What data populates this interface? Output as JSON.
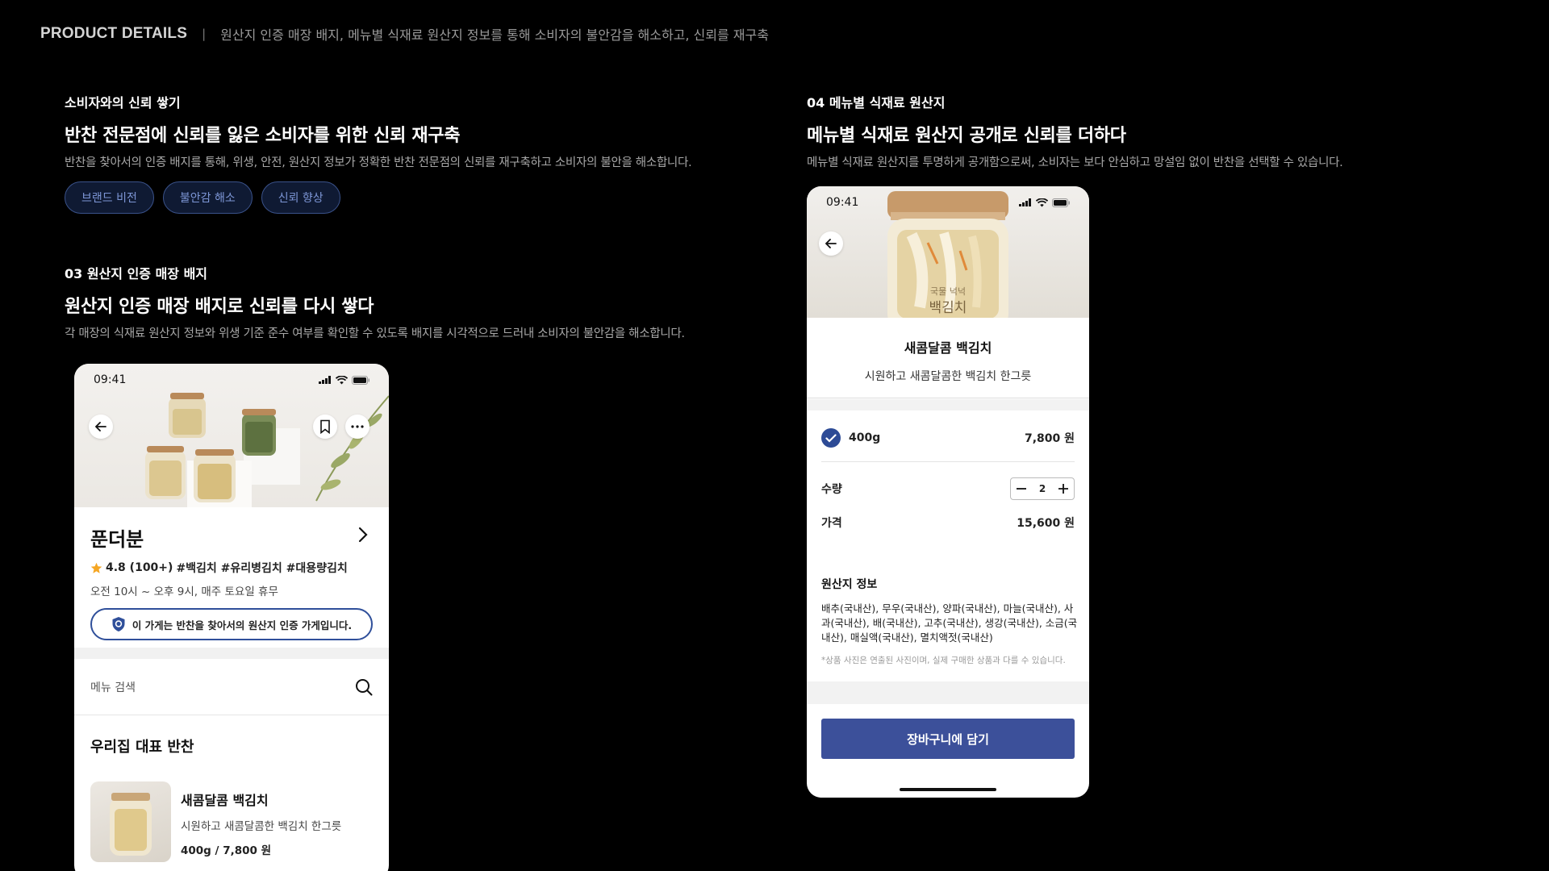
{
  "header": {
    "title": "PRODUCT DETAILS",
    "separator": "|",
    "description": "원산지 인증 매장 배지, 메뉴별 식재료 원산지 정보를 통해 소비자의 불안감을 해소하고, 신뢰를 재구축"
  },
  "section_trust": {
    "eyebrow": "소비자와의 신뢰 쌓기",
    "headline": "반찬 전문점에 신뢰를 잃은 소비자를 위한 신뢰 재구축",
    "description": "반찬을 찾아서의 인증 배지를 통해, 위생, 안전, 원산지 정보가 정확한 반찬 전문점의 신뢰를 재구축하고 소비자의 불안을 해소합니다.",
    "tags": [
      "브랜드 비전",
      "불안감 해소",
      "신뢰 향상"
    ]
  },
  "section_badge": {
    "eyebrow": "03 원산지 인증 매장 배지",
    "headline": "원산지 인증 매장 배지로 신뢰를 다시 쌓다",
    "description": "각 매장의 식재료 원산지 정보와 위생 기준 준수 여부를 확인할 수 있도록 배지를 시각적으로 드러내 소비자의 불안감을 해소합니다."
  },
  "section_origin": {
    "eyebrow": "04 메뉴별 식재료 원산지",
    "headline": "메뉴별 식재료 원산지 공개로 신뢰를 더하다",
    "description": "메뉴별 식재료 원산지를 투명하게 공개함으로써,  소비자는 보다 안심하고 망설임 없이 반찬을 선택할 수 있습니다."
  },
  "phone_store": {
    "time": "09:41",
    "store_name": "푼더분",
    "rating": "4.8 (100+)",
    "hashtags": "#백김치 #유리병김치 #대용량김치",
    "hours": "오전 10시 ~ 오후 9시, 매주 토요일 휴무",
    "cert_text": "이 가게는 반찬을 찾아서의 원산지 인증 가게입니다.",
    "search_placeholder": "메뉴 검색",
    "section_title": "우리집 대표 반찬",
    "menu": {
      "name": "새콤달콤 백김치",
      "subtitle": "시원하고 새콤달콤한 백김치 한그릇",
      "weight": "400g",
      "slash": "/",
      "price": "7,800 원"
    }
  },
  "phone_product": {
    "time": "09:41",
    "jar_label_top": "국물 넉넉",
    "jar_label": "백김치",
    "product_name": "새콤달콤 백김치",
    "product_subtitle": "시원하고 새콤달콤한 백김치 한그릇",
    "option_label": "400g",
    "option_price": "7,800 원",
    "qty_label": "수량",
    "qty_value": "2",
    "price_label": "가격",
    "price_value": "15,600 원",
    "origin_title": "원산지 정보",
    "origin_text": "배추(국내산), 무우(국내산), 양파(국내산), 마늘(국내산), 사과(국내산), 배(국내산), 고추(국내산), 생강(국내산), 소금(국내산), 매실액(국내산), 멸치액젓(국내산)",
    "origin_note": "*상품 사진은 연출된 사진이며, 실제 구매한 상품과 다를 수 있습니다.",
    "cart_button": "장바구니에 담기"
  },
  "colors": {
    "background": "#000000",
    "accent_blue": "#3c509a",
    "tag_border": "#3a528a",
    "tag_text": "#7d96d6",
    "star": "#f5a623"
  }
}
